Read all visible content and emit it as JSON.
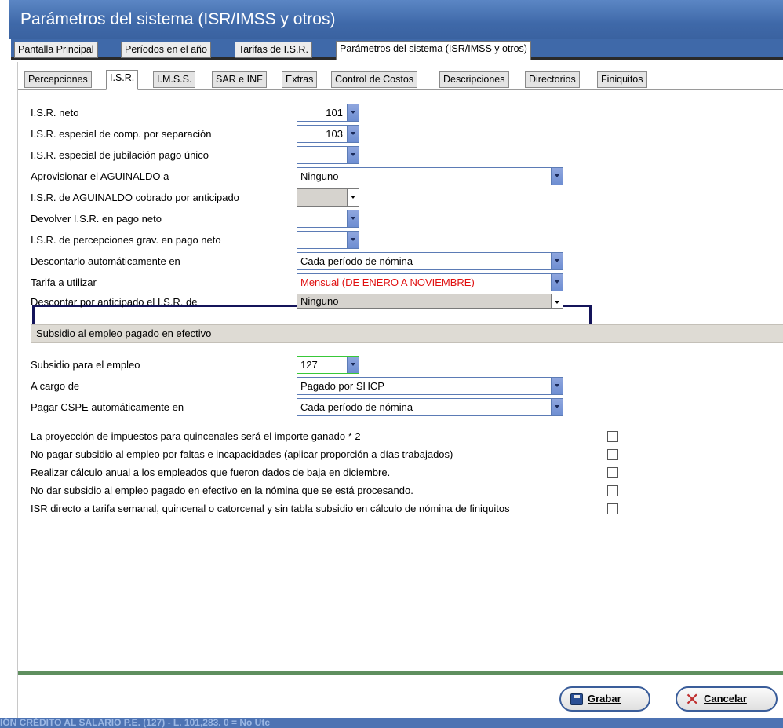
{
  "window": {
    "title": "Parámetros del sistema (ISR/IMSS y otros)"
  },
  "main_tabs": [
    {
      "label": "Pantalla Principal"
    },
    {
      "label": "Períodos en el año"
    },
    {
      "label": "Tarifas de I.S.R."
    },
    {
      "label": "Parámetros del sistema (ISR/IMSS y otros)"
    }
  ],
  "sub_tabs": [
    {
      "label": "Percepciones"
    },
    {
      "label": "I.S.R."
    },
    {
      "label": "I.M.S.S."
    },
    {
      "label": "SAR e INF"
    },
    {
      "label": "Extras"
    },
    {
      "label": "Control de Costos"
    },
    {
      "label": "Descripciones"
    },
    {
      "label": "Directorios"
    },
    {
      "label": "Finiquitos"
    }
  ],
  "isr_fields": [
    {
      "label": "I.S.R. neto",
      "value": "101"
    },
    {
      "label": "I.S.R. especial de comp. por separación",
      "value": "103"
    },
    {
      "label": "I.S.R. especial de jubilación pago único",
      "value": ""
    },
    {
      "label": "Aprovisionar el AGUINALDO a",
      "value": "Ninguno"
    },
    {
      "label": "I.S.R. de AGUINALDO cobrado por anticipado",
      "value": ""
    },
    {
      "label": "Devolver I.S.R. en pago neto",
      "value": ""
    },
    {
      "label": "I.S.R. de percepciones grav. en pago neto",
      "value": ""
    },
    {
      "label": "Descontarlo automáticamente en",
      "value": "Cada período de nómina"
    },
    {
      "label": "Tarifa a utilizar",
      "value": "Mensual (DE ENERO A NOVIEMBRE)"
    },
    {
      "label": "Descontar por anticipado el I.S.R. de",
      "value": "Ninguno"
    }
  ],
  "subsidio_section": {
    "title": "Subsidio al empleo pagado en efectivo"
  },
  "subsidio_fields": [
    {
      "label": "Subsidio para el empleo",
      "value": "127"
    },
    {
      "label": "A cargo de",
      "value": "Pagado por SHCP"
    },
    {
      "label": "Pagar CSPE automáticamente en",
      "value": "Cada período de nómina"
    }
  ],
  "checkboxes": [
    {
      "label": "La proyección de impuestos para quincenales será el importe ganado * 2",
      "checked": false
    },
    {
      "label": "No pagar subsidio al empleo por faltas e incapacidades (aplicar proporción a días trabajados)",
      "checked": false
    },
    {
      "label": "Realizar cálculo anual a los empleados que fueron dados de baja en diciembre.",
      "checked": false
    },
    {
      "label": "No dar subsidio al empleo pagado en efectivo en la nómina que se está procesando.",
      "checked": false
    },
    {
      "label": "ISR directo a tarifa semanal, quincenal o catorcenal y sin tabla subsidio en cálculo de nómina de finiquitos",
      "checked": false
    }
  ],
  "buttons": {
    "save": "Grabar",
    "cancel": "Cancelar"
  },
  "status_bar": {
    "text": "IÓN CRÉDITO AL SALARIO P.E. (127) - L. 101,283. 0 = No Utc"
  },
  "colors": {
    "title_bar": "#3f69a9",
    "highlight_border": "#14145a",
    "highlight_value": "#e01010",
    "separator": "#5f8f5f"
  }
}
